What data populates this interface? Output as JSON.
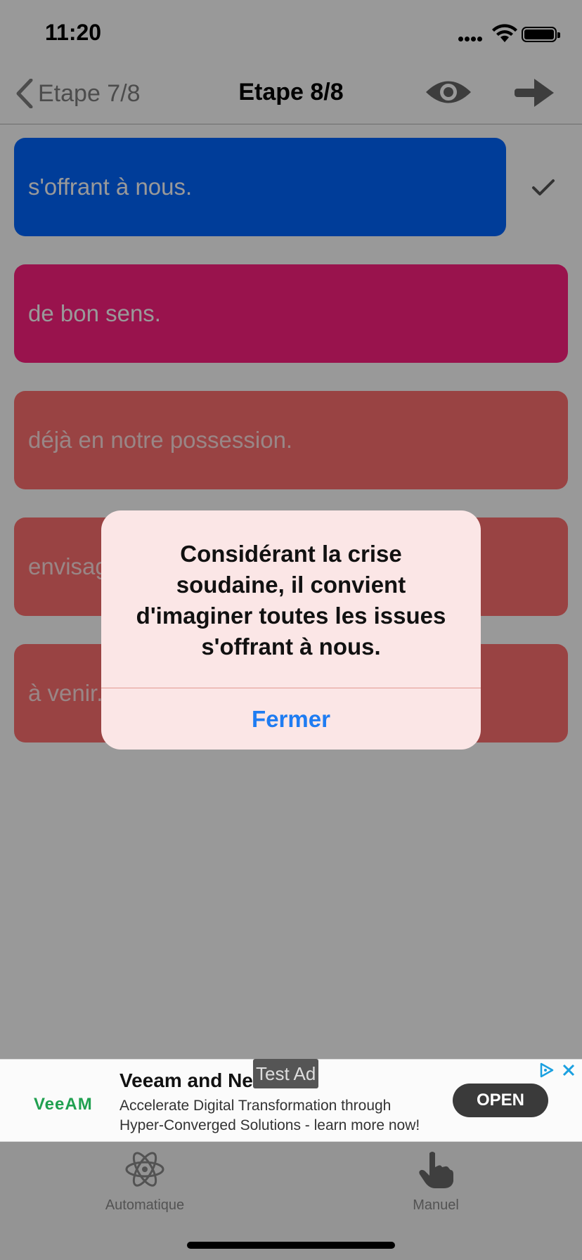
{
  "status_bar": {
    "time": "11:20"
  },
  "nav": {
    "back_label": "Etape 7/8",
    "title": "Etape 8/8"
  },
  "answers": [
    {
      "text": "s'offrant à nous.",
      "color": "#0066ff",
      "selected": true
    },
    {
      "text": "de bon sens.",
      "color": "#ff2080"
    },
    {
      "text": "déjà en notre possession.",
      "color": "#ff7070"
    },
    {
      "text": "envisag",
      "color": "#ff7070"
    },
    {
      "text": "à venir.",
      "color": "#ff7070"
    }
  ],
  "alert": {
    "message": "Considérant la crise soudaine, il convient d'imaginer toutes les issues s'offrant à nous.",
    "button_label": "Fermer"
  },
  "ad": {
    "badge": "Test Ad",
    "logo_text": "VeeAM",
    "title": "Veeam and Ne              CI",
    "line1": "Accelerate Digital Transformation through",
    "line2": "Hyper-Converged Solutions - learn more now!",
    "cta_label": "OPEN"
  },
  "tabs": [
    {
      "label": "Automatique",
      "icon": "atom-icon"
    },
    {
      "label": "Manuel",
      "icon": "hand-pointer-icon"
    }
  ],
  "colors": {
    "alert_bg": "#fbe6e6",
    "alert_button": "#1f7cf2",
    "overlay": "rgba(0,0,0,0.40)"
  }
}
